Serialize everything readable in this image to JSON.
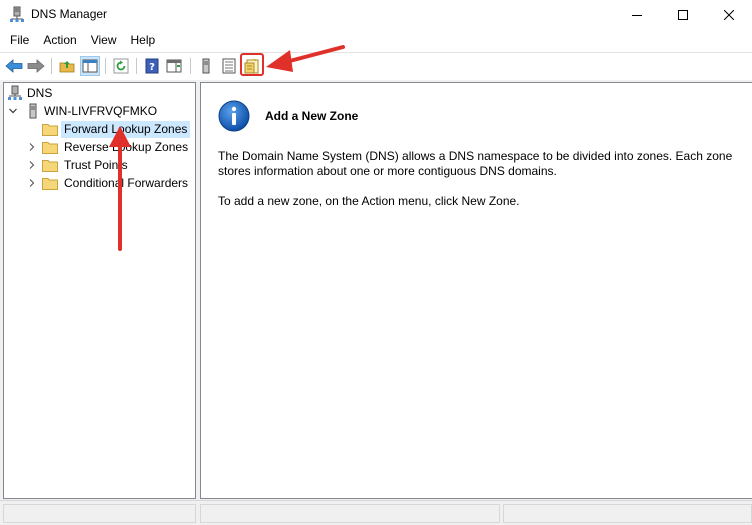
{
  "window": {
    "title": "DNS Manager",
    "icons": {
      "app": "dns-server-icon",
      "minimize": "minimize-icon",
      "maximize": "maximize-icon",
      "close": "close-icon"
    }
  },
  "menu": {
    "items": [
      "File",
      "Action",
      "View",
      "Help"
    ]
  },
  "toolbar": {
    "buttons": [
      "back-arrow-icon",
      "forward-arrow-icon",
      "up-folder-icon",
      "show-hide-console-tree-icon",
      "refresh-icon",
      "help-icon",
      "show-action-pane-icon",
      "server-icon",
      "list-view-icon",
      "new-zone-icon"
    ],
    "highlight_color": "#e0302a"
  },
  "tree": {
    "root": "DNS",
    "server": "WIN-LIVFRVQFMKO",
    "nodes": [
      {
        "label": "Forward Lookup Zones",
        "selected": true
      },
      {
        "label": "Reverse Lookup Zones",
        "selected": false
      },
      {
        "label": "Trust Points",
        "selected": false
      },
      {
        "label": "Conditional Forwarders",
        "selected": false
      }
    ]
  },
  "content": {
    "title": "Add a New Zone",
    "description": "The Domain Name System (DNS) allows a DNS namespace to be divided into zones. Each zone stores information about one or more contiguous DNS domains.",
    "instruction": "To add a new zone, on the Action menu, click New Zone.",
    "icon": "info-icon"
  },
  "colors": {
    "selection": "#cce8ff",
    "folder": "#f0c860",
    "info_blue": "#1565c0",
    "annotation_arrow": "#e0302a"
  }
}
